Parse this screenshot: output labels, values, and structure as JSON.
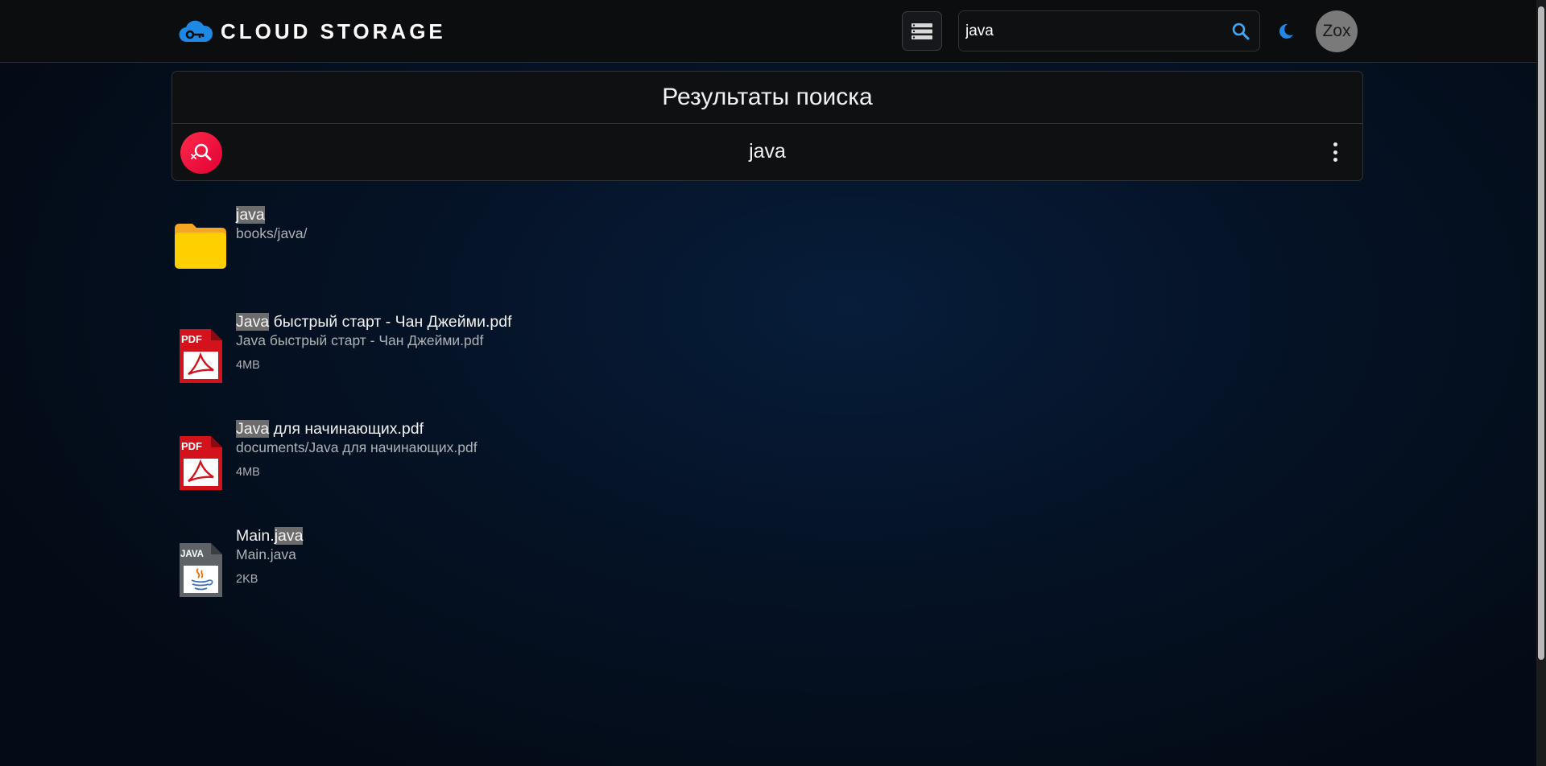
{
  "header": {
    "logo_text": "CLOUD STORAGE",
    "logo_icon": "cloud-key-icon",
    "view_toggle_icon": "list-view-icon",
    "search_value": "java",
    "search_icon": "search-icon",
    "theme_icon": "moon-icon",
    "avatar_initials": "Zox"
  },
  "results": {
    "title": "Результаты поиска",
    "query": "java",
    "clear_icon": "search-off-icon",
    "menu_icon": "more-vertical-icon"
  },
  "items": [
    {
      "type": "folder",
      "icon": "folder-icon",
      "name_prefix": "",
      "name_match": "java",
      "name_suffix": "",
      "path": "books/java/",
      "size": ""
    },
    {
      "type": "pdf",
      "icon": "pdf-file-icon",
      "name_prefix": "",
      "name_match": "Java",
      "name_suffix": " быстрый старт - Чан Джейми.pdf",
      "path": "Java быстрый старт - Чан Джейми.pdf",
      "size": "4MB"
    },
    {
      "type": "pdf",
      "icon": "pdf-file-icon",
      "name_prefix": "",
      "name_match": "Java",
      "name_suffix": " для начинающих.pdf",
      "path": "documents/Java для начинающих.pdf",
      "size": "4MB"
    },
    {
      "type": "java",
      "icon": "java-file-icon",
      "name_prefix": "Main.",
      "name_match": "java",
      "name_suffix": "",
      "path": "Main.java",
      "size": "2KB"
    }
  ],
  "colors": {
    "accent": "#1e88e5",
    "folder": "#ffd000",
    "pdf": "#d3121b",
    "clear_button": "#ff1744",
    "highlight": "#6c6c6c"
  }
}
